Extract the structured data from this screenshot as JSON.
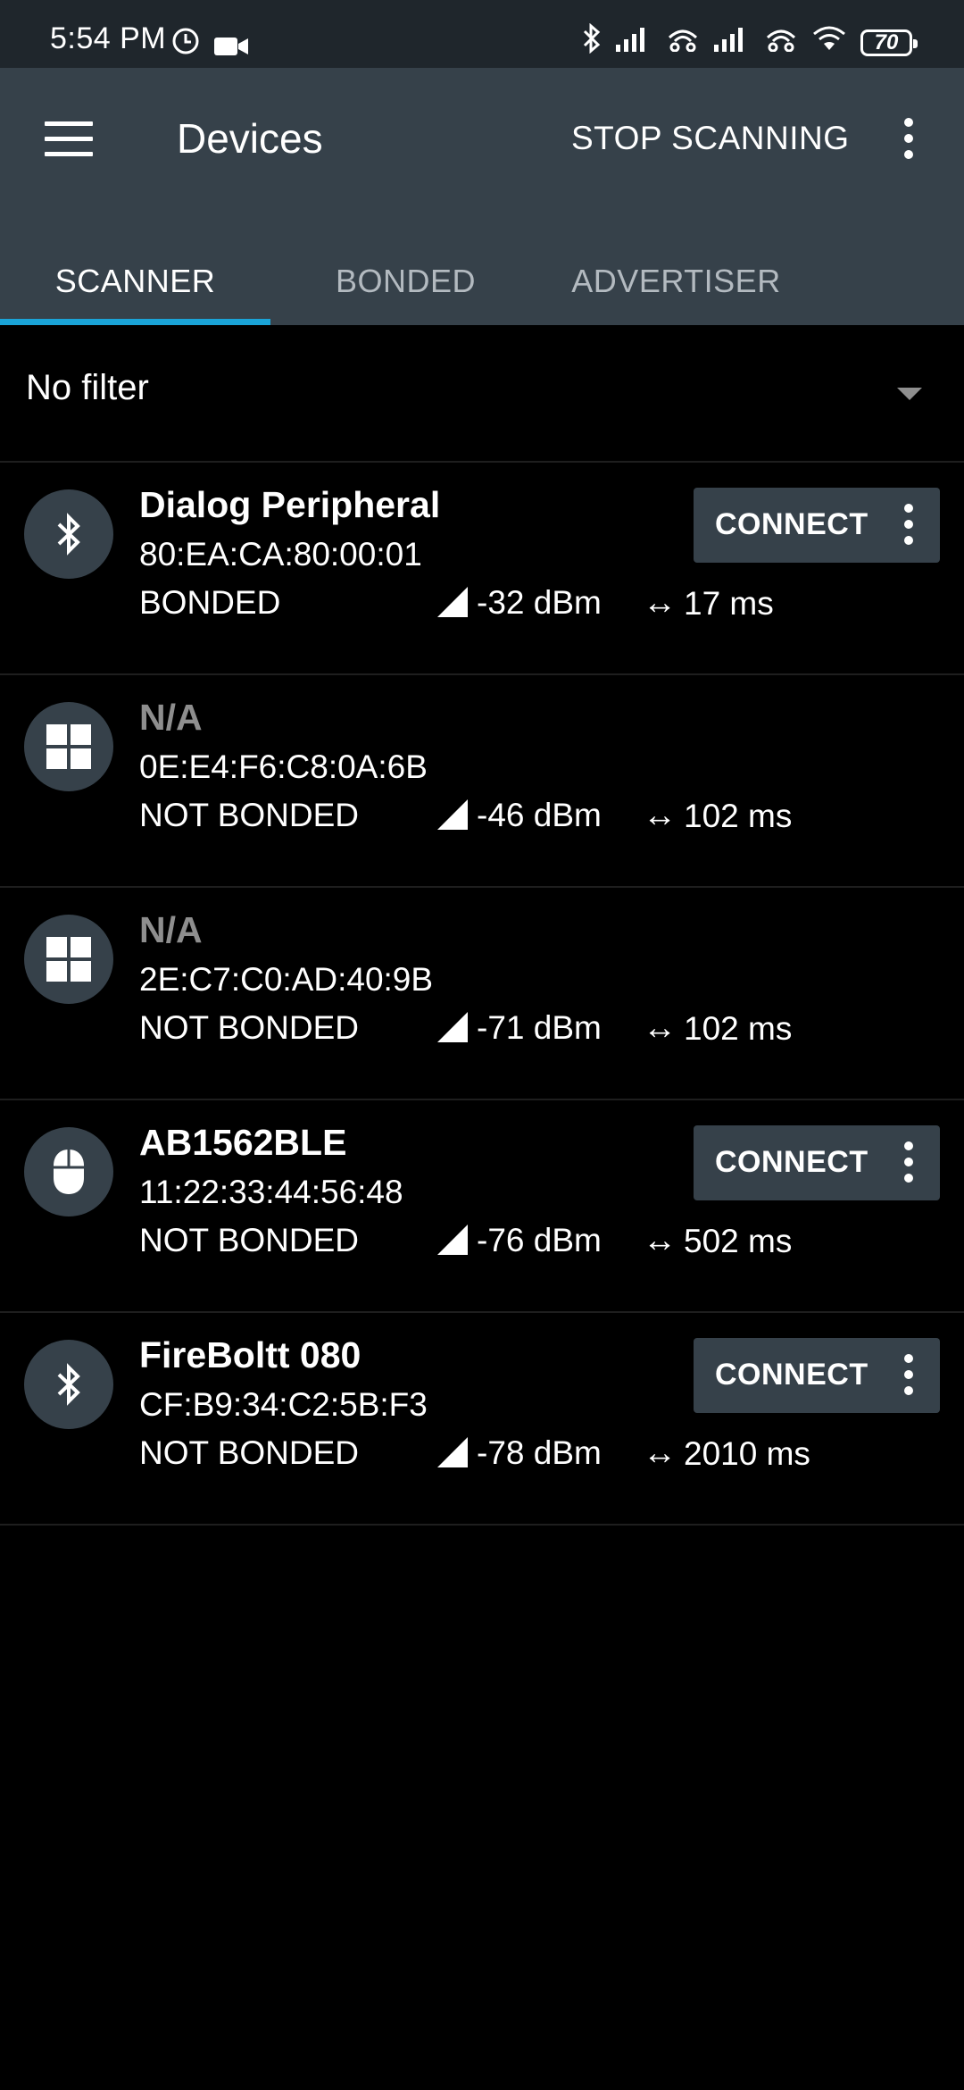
{
  "status_bar": {
    "time": "5:54 PM",
    "battery": "70",
    "icons": [
      "clock-icon",
      "video-icon",
      "bluetooth-icon",
      "signal-icon",
      "signal-icon",
      "wifi-icon",
      "battery-icon"
    ]
  },
  "app_bar": {
    "title": "Devices",
    "stop_scanning_label": "STOP SCANNING"
  },
  "tabs": [
    {
      "label": "SCANNER",
      "active": true
    },
    {
      "label": "BONDED",
      "active": false
    },
    {
      "label": "ADVERTISER",
      "active": false
    }
  ],
  "filter": {
    "label": "No filter"
  },
  "devices": [
    {
      "name": "Dialog Peripheral",
      "address": "80:EA:CA:80:00:01",
      "bond_state": "BONDED",
      "rssi": "-32 dBm",
      "interval": "17 ms",
      "icon": "bluetooth-icon",
      "connect_label": "CONNECT"
    },
    {
      "name": "N/A",
      "address": "0E:E4:F6:C8:0A:6B",
      "bond_state": "NOT BONDED",
      "rssi": "-46 dBm",
      "interval": "102 ms",
      "icon": "windows-icon"
    },
    {
      "name": "N/A",
      "address": "2E:C7:C0:AD:40:9B",
      "bond_state": "NOT BONDED",
      "rssi": "-71 dBm",
      "interval": "102 ms",
      "icon": "windows-icon"
    },
    {
      "name": "AB1562BLE",
      "address": "11:22:33:44:56:48",
      "bond_state": "NOT BONDED",
      "rssi": "-76 dBm",
      "interval": "502 ms",
      "icon": "mouse-icon",
      "connect_label": "CONNECT"
    },
    {
      "name": "FireBoltt 080",
      "address": "CF:B9:34:C2:5B:F3",
      "bond_state": "NOT BONDED",
      "rssi": "-78 dBm",
      "interval": "2010 ms",
      "icon": "bluetooth-icon",
      "connect_label": "CONNECT"
    }
  ],
  "colors": {
    "app_bar": "#36414a",
    "tab_indicator": "#1aa4d8",
    "background": "#000000"
  }
}
